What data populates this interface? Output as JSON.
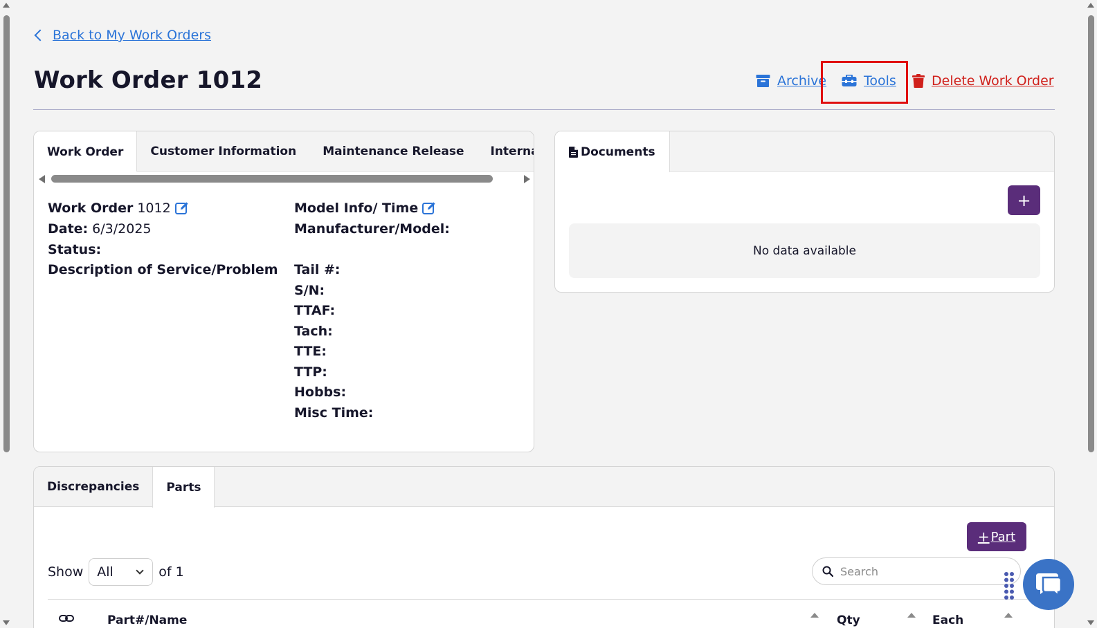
{
  "nav": {
    "back_label": "Back to My Work Orders"
  },
  "header": {
    "title": "Work Order 1012",
    "archive_label": "Archive",
    "tools_label": "Tools",
    "delete_label": "Delete Work Order"
  },
  "work_order_card": {
    "tabs": [
      {
        "label": "Work Order",
        "active": true
      },
      {
        "label": "Customer Information",
        "active": false
      },
      {
        "label": "Maintenance Release",
        "active": false
      },
      {
        "label": "Internal Not",
        "active": false
      }
    ],
    "left_fields": {
      "work_order_label": "Work Order",
      "work_order_value": "1012",
      "date_label": "Date:",
      "date_value": "6/3/2025",
      "status_label": "Status:",
      "description_label": "Description of Service/Problem"
    },
    "right_fields": {
      "model_info_label": "Model Info/ Time",
      "manufacturer_label": "Manufacturer/Model:",
      "tail_label": "Tail #:",
      "sn_label": "S/N:",
      "ttaf_label": "TTAF:",
      "tach_label": "Tach:",
      "tte_label": "TTE:",
      "ttp_label": "TTP:",
      "hobbs_label": "Hobbs:",
      "misc_label": "Misc Time:"
    }
  },
  "documents_card": {
    "tab_label": "Documents",
    "add_label": "+",
    "empty_text": "No data available"
  },
  "parts_card": {
    "tabs": [
      {
        "label": "Discrepancies",
        "active": false
      },
      {
        "label": "Parts",
        "active": true
      }
    ],
    "add_part_label": "Part",
    "show_label": "Show",
    "page_size": "All",
    "of_label": "of 1",
    "search_placeholder": "Search",
    "columns": [
      "Part#/Name",
      "Qty",
      "Each"
    ]
  },
  "colors": {
    "link_blue": "#2b74d8",
    "danger_red": "#d0201b",
    "brand_purple": "#5a2d7a",
    "highlight_red": "#e01010",
    "chat_blue": "#3a73c6"
  },
  "icons": {
    "back": "chevron-left-icon",
    "archive": "archive-box-icon",
    "tools": "toolbox-icon",
    "delete": "trash-icon",
    "edit": "edit-pencil-icon",
    "document": "document-icon",
    "search": "search-icon",
    "chat": "chat-bubble-icon",
    "drag": "drag-dots-icon"
  }
}
